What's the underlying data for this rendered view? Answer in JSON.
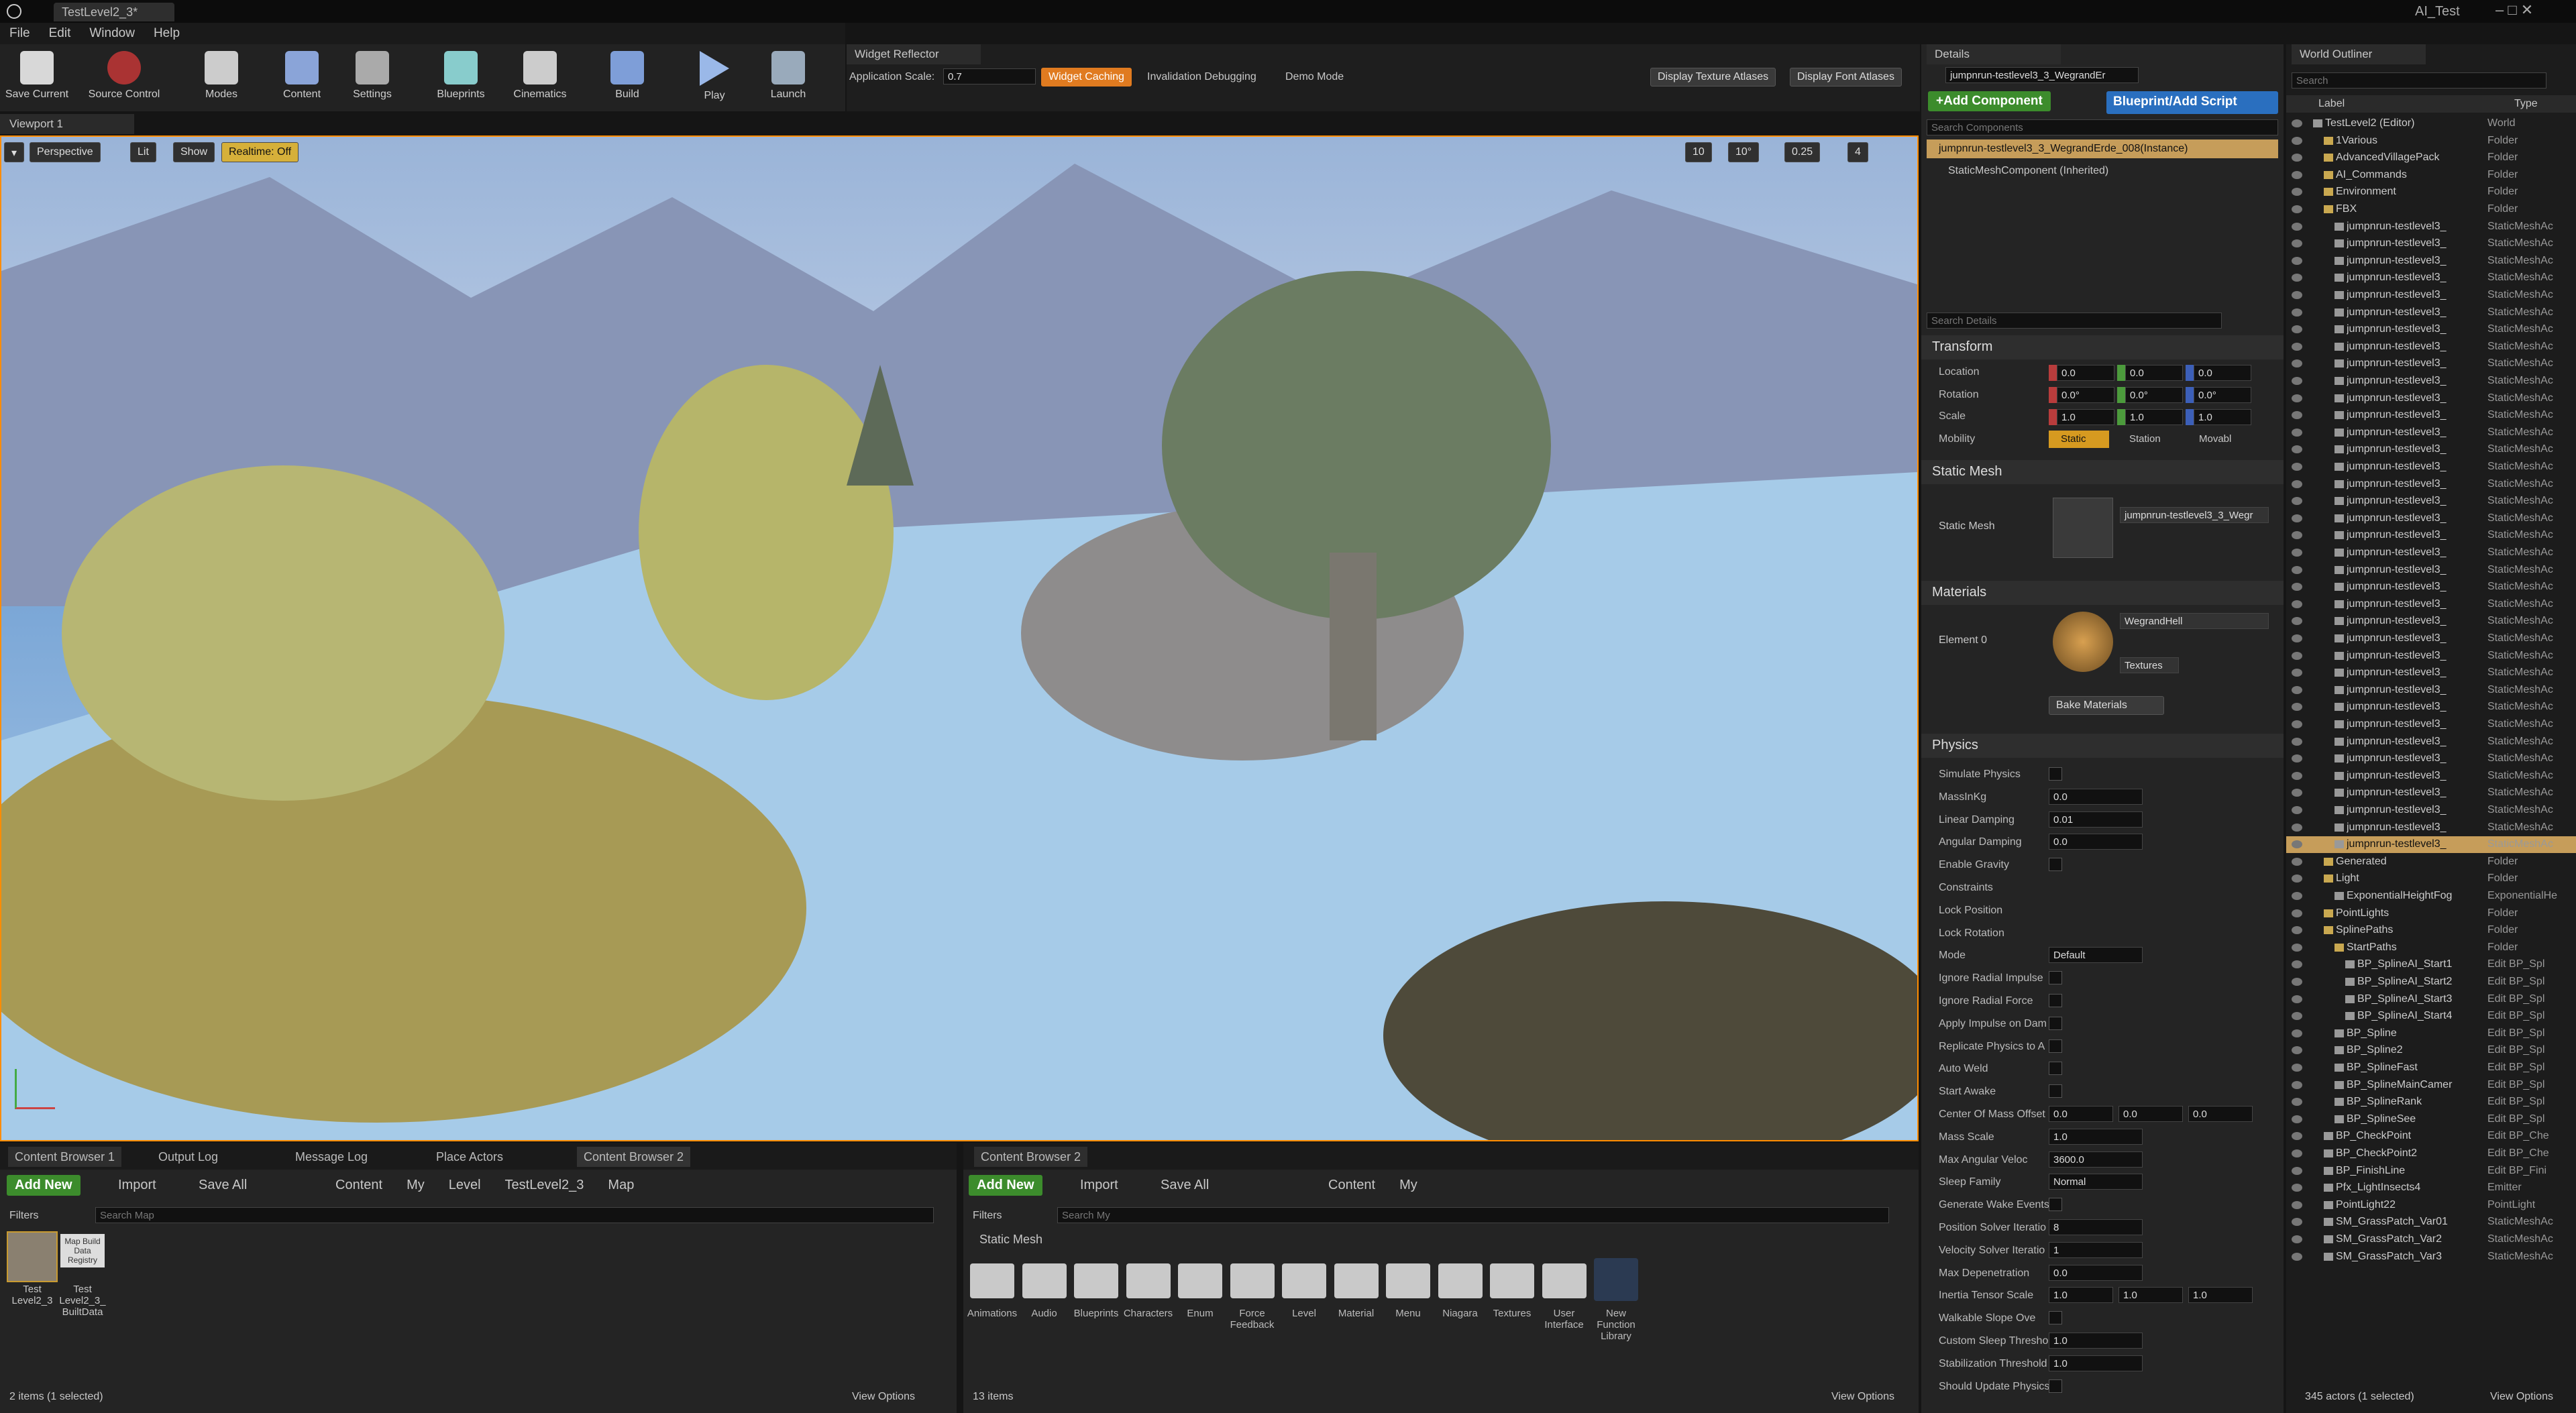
{
  "window": {
    "tab": "TestLevel2_3*",
    "project": "AI_Test"
  },
  "menu": [
    "File",
    "Edit",
    "Window",
    "Help"
  ],
  "toolbar": [
    "Save Current",
    "Source Control",
    "Modes",
    "Content",
    "Settings",
    "Blueprints",
    "Cinematics",
    "Build",
    "Play",
    "Launch"
  ],
  "widget_reflector": {
    "tab": "Widget Reflector",
    "app_scale_label": "Application Scale:",
    "app_scale_value": "0.7",
    "widget_caching": "Widget Caching",
    "invalidation": "Invalidation Debugging",
    "demo": "Demo Mode",
    "tex_atlases": "Display Texture Atlases",
    "font_atlases": "Display Font Atlases"
  },
  "viewport": {
    "tab": "Viewport 1",
    "perspective": "Perspective",
    "lit": "Lit",
    "show": "Show",
    "realtime": "Realtime: Off",
    "grid": "10",
    "angle": "10°",
    "scale": "0.25",
    "cam": "4"
  },
  "cb_left": {
    "tabs": [
      "Content Browser 1",
      "Output Log",
      "Message Log",
      "Place Actors",
      "Content Browser 2"
    ],
    "add_new": "Add New",
    "import": "Import",
    "save_all": "Save All",
    "path": [
      "Content",
      "My",
      "Level",
      "TestLevel2_3",
      "Map"
    ],
    "filters": "Filters",
    "search": "Search Map",
    "items": [
      {
        "name": "Test Level2_3"
      },
      {
        "name": "Test Level2_3_ BuiltData"
      }
    ],
    "thumb_label": "Map Build Data Registry",
    "status": "2 items (1 selected)",
    "view_options": "View Options"
  },
  "cb_right": {
    "tab": "Content Browser 2",
    "add_new": "Add New",
    "import": "Import",
    "save_all": "Save All",
    "path": [
      "Content",
      "My"
    ],
    "filters": "Filters",
    "search": "Search My",
    "section": "Static Mesh",
    "folders": [
      "Animations",
      "Audio",
      "Blueprints",
      "Characters",
      "Enum",
      "Force Feedback",
      "Level",
      "Material",
      "Menu",
      "Niagara",
      "Textures",
      "User Interface",
      "New Function Library"
    ],
    "status": "13 items",
    "view_options": "View Options"
  },
  "details": {
    "tab": "Details",
    "name": "jumpnrun-testlevel3_3_WegrandEr",
    "add_component": "+Add Component",
    "blueprint": "Blueprint/Add Script",
    "search_components": "Search Components",
    "instance": "jumpnrun-testlevel3_3_WegrandErde_008(Instance)",
    "component": "StaticMeshComponent (Inherited)",
    "search_details": "Search Details",
    "transform": {
      "title": "Transform",
      "location": "Location",
      "rotation": "Rotation",
      "scale": "Scale",
      "mobility": "Mobility",
      "loc": [
        "0.0",
        "0.0",
        "0.0"
      ],
      "rot": [
        "0.0°",
        "0.0°",
        "0.0°"
      ],
      "scl": [
        "1.0",
        "1.0",
        "1.0"
      ],
      "mob": [
        "Static",
        "Station",
        "Movabl"
      ]
    },
    "static_mesh": {
      "title": "Static Mesh",
      "label": "Static Mesh",
      "value": "jumpnrun-testlevel3_3_Wegr"
    },
    "materials": {
      "title": "Materials",
      "element": "Element 0",
      "value": "WegrandHell",
      "textures": "Textures",
      "bake": "Bake Materials"
    },
    "physics": {
      "title": "Physics",
      "rows": [
        [
          "Simulate Physics",
          ""
        ],
        [
          "MassInKg",
          "0.0"
        ],
        [
          "Linear Damping",
          "0.01"
        ],
        [
          "Angular Damping",
          "0.0"
        ],
        [
          "Enable Gravity",
          ""
        ],
        [
          "Constraints",
          ""
        ],
        [
          "Lock Position",
          ""
        ],
        [
          "Lock Rotation",
          ""
        ],
        [
          "Mode",
          "Default"
        ],
        [
          "Ignore Radial Impulse",
          ""
        ],
        [
          "Ignore Radial Force",
          ""
        ],
        [
          "Apply Impulse on Dam",
          ""
        ],
        [
          "Replicate Physics to A",
          ""
        ],
        [
          "Auto Weld",
          ""
        ],
        [
          "Start Awake",
          ""
        ],
        [
          "Center Of Mass Offset",
          ""
        ],
        [
          "Mass Scale",
          "1.0"
        ],
        [
          "Max Angular Veloc",
          "3600.0"
        ],
        [
          "Sleep Family",
          "Normal"
        ],
        [
          "Generate Wake Events",
          ""
        ],
        [
          "Position Solver Iteratio",
          "8"
        ],
        [
          "Velocity Solver Iteratio",
          "1"
        ],
        [
          "Max Depenetration",
          "0.0"
        ],
        [
          "Inertia Tensor Scale",
          ""
        ],
        [
          "Walkable Slope Ove",
          ""
        ],
        [
          "Custom Sleep Thresho",
          "1.0"
        ],
        [
          "Stabilization Threshold",
          "1.0"
        ],
        [
          "Should Update Physics",
          ""
        ]
      ],
      "com": [
        "0.0",
        "0.0",
        "0.0"
      ],
      "inertia": [
        "1.0",
        "1.0",
        "1.0"
      ]
    }
  },
  "outliner": {
    "tab": "World Outliner",
    "search": "Search",
    "col_label": "Label",
    "col_type": "Type",
    "status": "345 actors (1 selected)",
    "view_options": "View Options",
    "rows": [
      [
        "TestLevel2 (Editor)",
        "World",
        0
      ],
      [
        "1Various",
        "Folder",
        1
      ],
      [
        "AdvancedVillagePack",
        "Folder",
        1
      ],
      [
        "AI_Commands",
        "Folder",
        1
      ],
      [
        "Environment",
        "Folder",
        1
      ],
      [
        "FBX",
        "Folder",
        1
      ],
      [
        "jumpnrun-testlevel3_",
        "StaticMeshAc",
        2
      ],
      [
        "jumpnrun-testlevel3_",
        "StaticMeshAc",
        2
      ],
      [
        "jumpnrun-testlevel3_",
        "StaticMeshAc",
        2
      ],
      [
        "jumpnrun-testlevel3_",
        "StaticMeshAc",
        2
      ],
      [
        "jumpnrun-testlevel3_",
        "StaticMeshAc",
        2
      ],
      [
        "jumpnrun-testlevel3_",
        "StaticMeshAc",
        2
      ],
      [
        "jumpnrun-testlevel3_",
        "StaticMeshAc",
        2
      ],
      [
        "jumpnrun-testlevel3_",
        "StaticMeshAc",
        2
      ],
      [
        "jumpnrun-testlevel3_",
        "StaticMeshAc",
        2
      ],
      [
        "jumpnrun-testlevel3_",
        "StaticMeshAc",
        2
      ],
      [
        "jumpnrun-testlevel3_",
        "StaticMeshAc",
        2
      ],
      [
        "jumpnrun-testlevel3_",
        "StaticMeshAc",
        2
      ],
      [
        "jumpnrun-testlevel3_",
        "StaticMeshAc",
        2
      ],
      [
        "jumpnrun-testlevel3_",
        "StaticMeshAc",
        2
      ],
      [
        "jumpnrun-testlevel3_",
        "StaticMeshAc",
        2
      ],
      [
        "jumpnrun-testlevel3_",
        "StaticMeshAc",
        2
      ],
      [
        "jumpnrun-testlevel3_",
        "StaticMeshAc",
        2
      ],
      [
        "jumpnrun-testlevel3_",
        "StaticMeshAc",
        2
      ],
      [
        "jumpnrun-testlevel3_",
        "StaticMeshAc",
        2
      ],
      [
        "jumpnrun-testlevel3_",
        "StaticMeshAc",
        2
      ],
      [
        "jumpnrun-testlevel3_",
        "StaticMeshAc",
        2
      ],
      [
        "jumpnrun-testlevel3_",
        "StaticMeshAc",
        2
      ],
      [
        "jumpnrun-testlevel3_",
        "StaticMeshAc",
        2
      ],
      [
        "jumpnrun-testlevel3_",
        "StaticMeshAc",
        2
      ],
      [
        "jumpnrun-testlevel3_",
        "StaticMeshAc",
        2
      ],
      [
        "jumpnrun-testlevel3_",
        "StaticMeshAc",
        2
      ],
      [
        "jumpnrun-testlevel3_",
        "StaticMeshAc",
        2
      ],
      [
        "jumpnrun-testlevel3_",
        "StaticMeshAc",
        2
      ],
      [
        "jumpnrun-testlevel3_",
        "StaticMeshAc",
        2
      ],
      [
        "jumpnrun-testlevel3_",
        "StaticMeshAc",
        2
      ],
      [
        "jumpnrun-testlevel3_",
        "StaticMeshAc",
        2
      ],
      [
        "jumpnrun-testlevel3_",
        "StaticMeshAc",
        2
      ],
      [
        "jumpnrun-testlevel3_",
        "StaticMeshAc",
        2
      ],
      [
        "jumpnrun-testlevel3_",
        "StaticMeshAc",
        2
      ],
      [
        "jumpnrun-testlevel3_",
        "StaticMeshAc",
        2
      ],
      [
        "jumpnrun-testlevel3_",
        "StaticMeshAc",
        2
      ],
      [
        "jumpnrun-testlevel3_",
        "StaticMeshAc",
        2
      ],
      [
        "Generated",
        "Folder",
        1
      ],
      [
        "Light",
        "Folder",
        1
      ],
      [
        "ExponentialHeightFog",
        "ExponentialHe",
        2
      ],
      [
        "PointLights",
        "Folder",
        1
      ],
      [
        "SplinePaths",
        "Folder",
        1
      ],
      [
        "StartPaths",
        "Folder",
        2
      ],
      [
        "BP_SplineAI_Start1",
        "Edit BP_Spl",
        3
      ],
      [
        "BP_SplineAI_Start2",
        "Edit BP_Spl",
        3
      ],
      [
        "BP_SplineAI_Start3",
        "Edit BP_Spl",
        3
      ],
      [
        "BP_SplineAI_Start4",
        "Edit BP_Spl",
        3
      ],
      [
        "BP_Spline",
        "Edit BP_Spl",
        2
      ],
      [
        "BP_Spline2",
        "Edit BP_Spl",
        2
      ],
      [
        "BP_SplineFast",
        "Edit BP_Spl",
        2
      ],
      [
        "BP_SplineMainCamer",
        "Edit BP_Spl",
        2
      ],
      [
        "BP_SplineRank",
        "Edit BP_Spl",
        2
      ],
      [
        "BP_SplineSee",
        "Edit BP_Spl",
        2
      ],
      [
        "BP_CheckPoint",
        "Edit BP_Che",
        1
      ],
      [
        "BP_CheckPoint2",
        "Edit BP_Che",
        1
      ],
      [
        "BP_FinishLine",
        "Edit BP_Fini",
        1
      ],
      [
        "Pfx_LightInsects4",
        "Emitter",
        1
      ],
      [
        "PointLight22",
        "PointLight",
        1
      ],
      [
        "SM_GrassPatch_Var01",
        "StaticMeshAc",
        1
      ],
      [
        "SM_GrassPatch_Var2",
        "StaticMeshAc",
        1
      ],
      [
        "SM_GrassPatch_Var3",
        "StaticMeshAc",
        1
      ]
    ],
    "selected_index": 42
  }
}
